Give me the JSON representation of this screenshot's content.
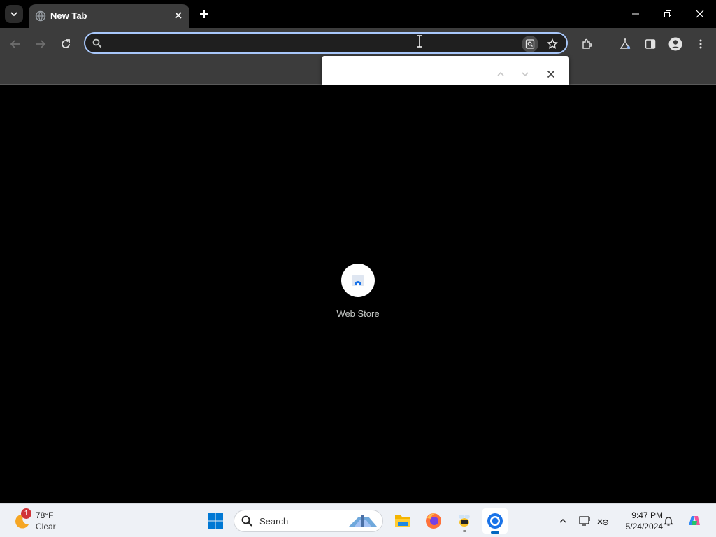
{
  "browser": {
    "tab": {
      "title": "New Tab"
    },
    "omnibox": {
      "value": "",
      "placeholder": ""
    },
    "findbar": {
      "value": ""
    }
  },
  "content": {
    "shortcuts": [
      {
        "label": "Web Store",
        "icon": "web-store-icon"
      }
    ]
  },
  "taskbar": {
    "weather": {
      "temperature": "78°F",
      "condition": "Clear",
      "badge": "1"
    },
    "search_label": "Search",
    "clock": {
      "time": "9:47 PM",
      "date": "5/24/2024"
    },
    "apps": [
      "file-explorer",
      "firefox",
      "bee-app",
      "chrome"
    ]
  },
  "colors": {
    "accent": "#a8c7fa",
    "toolbar": "#3c3c3c",
    "tab_active": "#3c3c3c",
    "taskbar": "#eef1f6"
  }
}
